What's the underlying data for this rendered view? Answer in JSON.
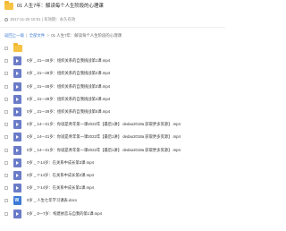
{
  "header": {
    "title": "01 人生7年：解读每个人生阶段的心理课",
    "date": "2017-11-20 10:01",
    "expiry": "有效期：永久有效"
  },
  "breadcrumb": {
    "back": "返回上一级",
    "all": "全部文件",
    "current": "01 人生7年：解读每个人生阶段的心理课"
  },
  "files": [
    {
      "name": "",
      "type": "folder"
    },
    {
      "name": "0岁 _ 21—28岁：组织关系的自我挑战第1课.mp4",
      "type": "video"
    },
    {
      "name": "0岁 _ 21—28岁：组织关系的自我挑战第2课.mp4",
      "type": "video"
    },
    {
      "name": "0岁 _ 21—28岁：组织关系的自我挑战第3课.mp4",
      "type": "video"
    },
    {
      "name": "0岁 _ 21—28岁：组织关系的自我挑战第4课.mp4",
      "type": "video"
    },
    {
      "name": "0岁 _ 21—28岁：组织关系的自我挑战第5课.mp4",
      "type": "video"
    },
    {
      "name": "0岁 _ 14—21岁：你就是青年第一课2022年【最后1讲】 dedao2018a 获取更多资源】.mp4",
      "type": "video"
    },
    {
      "name": "0岁 _ 14—21岁：你就是青年第一课2022年【最后1讲】 dedao2018a 获取更多资源】.mp4",
      "type": "video"
    },
    {
      "name": "0岁 _ 14—21岁：你就是青年第一课2022年【最后1讲】 dedao2018a 获取更多资源】.mp4",
      "type": "video"
    },
    {
      "name": "0岁 _ 7-14岁：在关系中成长第3课.mp4",
      "type": "video"
    },
    {
      "name": "0岁 _ 7-14岁：在关系中成长第2课.mp4",
      "type": "video"
    },
    {
      "name": "0岁 _ 7-14岁：在关系中成长第1课.mp4",
      "type": "video"
    },
    {
      "name": "0岁 _ 人生七年学习课表.docx",
      "type": "doc"
    },
    {
      "name": "0岁 _ 0—7岁：构建依恋与自我的第1课.mp4",
      "type": "video"
    }
  ]
}
